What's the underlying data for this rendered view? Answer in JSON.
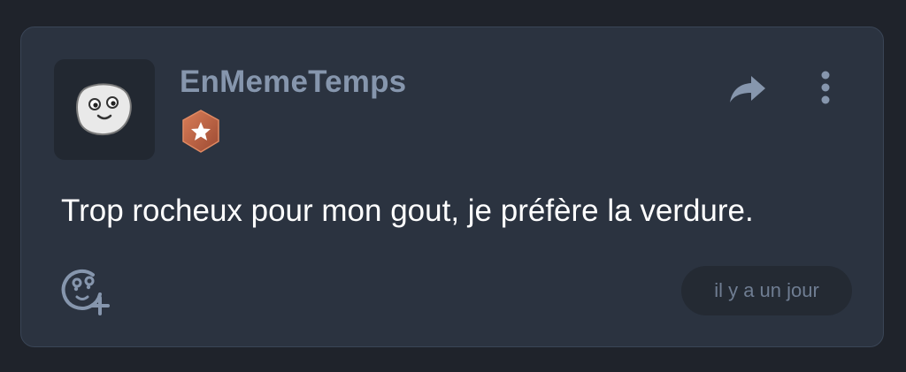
{
  "comment": {
    "author": "EnMemeTemps",
    "text": "Trop rocheux pour mon gout, je préfère la verdure.",
    "timestamp": "il y a un jour",
    "icons": {
      "avatar": "smiling-face-avatar",
      "badge": "star-badge-icon",
      "share": "share-icon",
      "more": "more-vertical-icon",
      "react": "add-reaction-icon"
    },
    "colors": {
      "background": "#1f232b",
      "card": "#2b3340",
      "username": "#8696ad",
      "badge": "#c0694a",
      "text": "#ffffff",
      "muted": "#6f7d92"
    }
  }
}
